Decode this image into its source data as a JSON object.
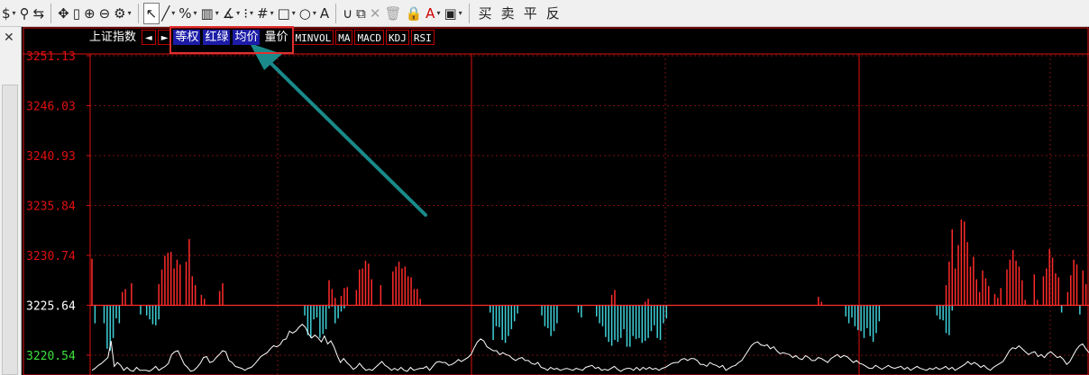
{
  "toolbar": {
    "items": [
      {
        "id": "currency",
        "glyph": "$",
        "dropdown": true
      },
      {
        "id": "filter",
        "glyph": "⚲",
        "dropdown": false
      },
      {
        "id": "fit",
        "glyph": "⇆",
        "dropdown": false
      },
      {
        "id": "move",
        "glyph": "✥",
        "dropdown": false
      },
      {
        "id": "candle",
        "glyph": "▯",
        "dropdown": false
      },
      {
        "id": "zoom-in",
        "glyph": "⊕",
        "dropdown": false
      },
      {
        "id": "zoom-out",
        "glyph": "⊖",
        "dropdown": false
      },
      {
        "id": "settings",
        "glyph": "⚙",
        "dropdown": true
      },
      {
        "id": "pointer",
        "glyph": "↖",
        "dropdown": false,
        "active": true
      },
      {
        "id": "line",
        "glyph": "╱",
        "dropdown": true
      },
      {
        "id": "percent",
        "glyph": "%",
        "dropdown": true
      },
      {
        "id": "ruler",
        "glyph": "▥",
        "dropdown": true
      },
      {
        "id": "angle",
        "glyph": "∡",
        "dropdown": true
      },
      {
        "id": "channel",
        "glyph": "⁝",
        "dropdown": true
      },
      {
        "id": "grid",
        "glyph": "#",
        "dropdown": true
      },
      {
        "id": "rect",
        "glyph": "□",
        "dropdown": true
      },
      {
        "id": "circle",
        "glyph": "○",
        "dropdown": true
      },
      {
        "id": "text",
        "glyph": "A",
        "dropdown": false
      },
      {
        "id": "magnet",
        "glyph": "∪",
        "dropdown": false
      },
      {
        "id": "copy",
        "glyph": "⧉",
        "dropdown": false
      },
      {
        "id": "delete",
        "glyph": "✕",
        "dropdown": false,
        "disabled": true
      },
      {
        "id": "trash",
        "glyph": "🗑",
        "dropdown": false,
        "disabled": true
      },
      {
        "id": "lock",
        "glyph": "🔒",
        "dropdown": false
      },
      {
        "id": "font-color",
        "glyph": "A",
        "dropdown": true,
        "red": true
      },
      {
        "id": "save",
        "glyph": "▣",
        "dropdown": true
      }
    ],
    "trade": [
      "买",
      "卖",
      "平",
      "反"
    ]
  },
  "legend": {
    "index_name": "上证指数",
    "left_arrow": "◄",
    "right_arrow": "►",
    "equal_weight": "等权",
    "red_green": "红绿",
    "avg_price": "均价",
    "volume_price": "量价",
    "indicators": [
      "MINVOL",
      "MA",
      "MACD",
      "KDJ",
      "RSI"
    ]
  },
  "colors": {
    "up": "#ff2a2a",
    "down": "#3fd0d8",
    "line": "#ffffff",
    "axis_red": "#e01010",
    "axis_green": "#3ee03e",
    "grid": "#7a1010"
  },
  "chart_data": {
    "type": "bar",
    "y_ticks": [
      "3251.13",
      "3246.03",
      "3240.93",
      "3235.84",
      "3230.74",
      "3225.64",
      "3220.54"
    ],
    "ylim": [
      3220.54,
      3251.13
    ],
    "baseline": 3225.64,
    "bars": [
      3230.4,
      3225.6,
      3225.6,
      3225.6,
      3225.6,
      3225.6,
      3225.6,
      3225.6,
      3225.6,
      3225.6,
      3227.0,
      3227.3,
      3225.6,
      3227.9,
      3225.6,
      3225.6,
      3225.6,
      3225.6,
      3225.6,
      3225.6,
      3225.6,
      3225.6,
      3227.8,
      3229.3,
      3230.7,
      3231.0,
      3231.1,
      3229.4,
      3230.3,
      3229.8,
      3225.6,
      3230.1,
      3232.4,
      3228.6,
      3227.7,
      3225.6,
      3226.7,
      3226.3,
      3225.6,
      3225.6,
      3225.6,
      3225.6,
      3227.1,
      3227.9,
      3225.6,
      3225.6,
      3225.6,
      3225.6,
      3225.6,
      3225.6,
      3225.6,
      3225.6,
      3225.6,
      3225.6,
      3225.6,
      3225.6,
      3225.6,
      3225.6,
      3225.6,
      3225.6,
      3225.6,
      3225.6,
      3225.6,
      3225.6,
      3225.6,
      3225.6,
      3225.6,
      3225.6,
      3225.6,
      3225.6,
      3225.6,
      3225.6,
      3225.6,
      3225.6,
      3225.6,
      3225.6,
      3225.6,
      3225.6,
      3228.2,
      3227.3,
      3226.4,
      3225.6,
      3226.6,
      3227.4,
      3227.5,
      3225.6,
      3225.6,
      3227.2,
      3229.3,
      3229.4,
      3230.2,
      3229.9,
      3228.3,
      3225.6,
      3225.6,
      3227.7,
      3225.6,
      3225.6,
      3225.6,
      3229.1,
      3229.6,
      3230.1,
      3229.4,
      3229.6,
      3228.6,
      3228.5,
      3227.3,
      3227.3,
      3226.3,
      3225.6,
      3225.6,
      3225.6,
      3225.6,
      3225.6,
      3225.6,
      3225.6,
      3225.6,
      3225.6,
      3225.6,
      3225.6,
      3225.6,
      3225.6,
      3225.6,
      3225.6,
      3225.6,
      3225.6,
      3225.6,
      3225.6,
      3225.6,
      3225.6,
      3225.6,
      3225.6,
      3225.6,
      3225.6,
      3225.6,
      3225.6,
      3225.6,
      3225.6,
      3225.6,
      3225.6,
      3225.6,
      3225.6,
      3225.6,
      3225.6,
      3225.6,
      3225.6,
      3225.6,
      3225.6,
      3225.6,
      3225.6,
      3225.6,
      3225.6,
      3225.6,
      3225.6,
      3225.6,
      3225.6,
      3225.6,
      3225.6,
      3225.6,
      3225.6,
      3225.6,
      3225.6,
      3225.6,
      3225.6,
      3225.6,
      3225.6,
      3225.6,
      3225.6,
      3225.6,
      3225.6,
      3225.6,
      3226.7,
      3227.2,
      3225.6,
      3225.6,
      3225.6,
      3225.6,
      3225.6,
      3225.6,
      3225.6,
      3225.6,
      3225.6,
      3226.0,
      3226.3,
      3225.6,
      3225.6,
      3225.6,
      3225.6,
      3225.6,
      3225.6,
      3225.6,
      3225.6,
      3225.6,
      3225.6,
      3225.6,
      3225.6,
      3225.6,
      3225.6,
      3225.6,
      3225.6,
      3225.6,
      3225.6,
      3225.6,
      3225.6,
      3225.6,
      3225.6,
      3225.6,
      3225.6,
      3225.6,
      3225.6,
      3225.6,
      3225.6,
      3225.6,
      3225.6,
      3225.6,
      3225.6,
      3225.6,
      3225.6,
      3225.6,
      3225.6,
      3225.6,
      3225.6,
      3225.6,
      3225.6,
      3225.6,
      3225.6,
      3225.6,
      3225.6,
      3225.6,
      3225.6,
      3225.6,
      3225.6,
      3225.6,
      3225.6,
      3225.6,
      3225.6,
      3225.6,
      3225.6,
      3225.6,
      3226.5,
      3226.0,
      3225.6,
      3225.6,
      3225.6,
      3225.6,
      3225.6,
      3225.6,
      3225.6,
      3225.6,
      3225.6,
      3225.6,
      3225.6,
      3225.6,
      3225.6,
      3225.6,
      3225.6,
      3225.6,
      3225.6,
      3225.6,
      3225.6,
      3225.6,
      3225.6,
      3225.6,
      3225.6,
      3225.6,
      3225.6,
      3225.6,
      3225.6,
      3225.6,
      3225.6,
      3225.6,
      3225.6,
      3225.6,
      3225.6,
      3225.6,
      3225.6,
      3225.6,
      3225.6,
      3225.6,
      3225.6,
      3225.6,
      3227.7,
      3230.1,
      3233.4,
      3229.4,
      3231.8,
      3234.4,
      3234.2,
      3232.1,
      3229.6,
      3230.6,
      3228.3,
      3227.0,
      3229.2,
      3228.4,
      3227.6,
      3225.6,
      3226.8,
      3226.4,
      3227.4,
      3225.6,
      3229.3,
      3230.3,
      3231.3,
      3230.2,
      3229.6,
      3228.2,
      3226.2,
      3225.6,
      3225.6,
      3228.8,
      3226.2,
      3225.6,
      3228.6,
      3229.4,
      3231.4,
      3230.5,
      3228.9,
      3228.5,
      3225.6,
      3225.6,
      3227.0,
      3228.7,
      3230.3,
      3229.8,
      3225.6,
      3229.2,
      3227.8
    ],
    "downbars": [
      3225.64,
      3223.8,
      3225.64,
      3225.64,
      3223.8,
      3221.2,
      3221.0,
      3222.3,
      3224.3,
      3223.8,
      3225.64,
      3225.64,
      3225.64,
      3225.64,
      3225.64,
      3225.64,
      3224.7,
      3225.64,
      3224.6,
      3224.2,
      3223.7,
      3223.6,
      3224.2,
      3225.64,
      3225.64,
      3225.64,
      3225.64,
      3225.64,
      3225.64,
      3225.64,
      3225.64,
      3225.64,
      3225.64,
      3225.64,
      3225.64,
      3225.64,
      3225.64,
      3225.64,
      3225.64,
      3225.64,
      3225.64,
      3225.64,
      3225.64,
      3225.64,
      3225.64,
      3225.64,
      3225.64,
      3225.64,
      3225.64,
      3225.64,
      3225.64,
      3225.64,
      3225.64,
      3225.64,
      3225.64,
      3225.64,
      3225.64,
      3225.64,
      3225.64,
      3225.64,
      3225.64,
      3225.64,
      3225.64,
      3225.64,
      3225.64,
      3225.64,
      3225.64,
      3225.64,
      3225.64,
      3225.64,
      3224.6,
      3222.6,
      3222.3,
      3224.2,
      3224.4,
      3222.3,
      3222.7,
      3223.2,
      3225.3,
      3225.5,
      3223.8,
      3224.3,
      3225.0,
      3225.3,
      3225.64,
      3225.64,
      3225.64,
      3225.64,
      3225.64,
      3225.64,
      3225.64,
      3225.64,
      3225.64,
      3225.64,
      3225.64,
      3225.64,
      3225.64,
      3225.64,
      3225.64,
      3225.64,
      3225.64,
      3225.64,
      3225.64,
      3225.64,
      3225.64,
      3225.64,
      3225.64,
      3225.64,
      3225.64,
      3225.64,
      3225.64,
      3225.64,
      3225.64,
      3225.64,
      3225.64,
      3225.64,
      3225.64,
      3225.64,
      3225.64,
      3225.64,
      3225.64,
      3225.64,
      3225.64,
      3225.64,
      3225.64,
      3225.64,
      3225.64,
      3225.64,
      3225.64,
      3225.64,
      3225.64,
      3224.9,
      3222.1,
      3223.5,
      3223.4,
      3222.1,
      3221.8,
      3222.5,
      3223.2,
      3224.0,
      3224.8,
      3225.64,
      3225.64,
      3225.64,
      3225.64,
      3225.64,
      3225.64,
      3225.64,
      3224.6,
      3223.5,
      3223.3,
      3222.5,
      3223.0,
      3223.8,
      3225.64,
      3225.64,
      3225.64,
      3225.64,
      3225.64,
      3225.64,
      3224.9,
      3224.4,
      3225.64,
      3225.64,
      3225.64,
      3225.64,
      3224.5,
      3223.8,
      3223.5,
      3222.4,
      3221.9,
      3221.5,
      3222.1,
      3221.9,
      3222.3,
      3223.2,
      3221.4,
      3221.4,
      3222.5,
      3222.2,
      3222.3,
      3221.8,
      3222.0,
      3222.3,
      3223.0,
      3223.6,
      3222.3,
      3222.1,
      3223.8,
      3224.3,
      3225.64,
      3225.64,
      3225.64,
      3225.64,
      3225.64,
      3225.64,
      3225.64,
      3225.64,
      3225.64,
      3225.64,
      3225.64,
      3225.64,
      3225.64,
      3225.64,
      3225.64,
      3225.64,
      3225.64,
      3225.64,
      3225.64,
      3225.64,
      3225.64,
      3225.64,
      3225.64,
      3225.64,
      3225.64,
      3225.64,
      3225.64,
      3225.64,
      3225.64,
      3225.64,
      3225.64,
      3225.64,
      3225.64,
      3225.64,
      3225.64,
      3225.64,
      3225.64,
      3225.64,
      3225.64,
      3225.64,
      3225.64,
      3225.64,
      3225.64,
      3225.64,
      3225.64,
      3225.64,
      3225.64,
      3225.64,
      3225.64,
      3225.64,
      3225.64,
      3225.64,
      3225.64,
      3225.64,
      3225.64,
      3225.64,
      3225.64,
      3225.64,
      3224.5,
      3223.8,
      3224.4,
      3223.5,
      3223.1,
      3223.0,
      3222.3,
      3223.3,
      3222.5,
      3221.9,
      3222.8,
      3224.0,
      3225.64,
      3225.64,
      3225.64,
      3225.64,
      3225.64,
      3225.64,
      3225.64,
      3225.64,
      3225.64,
      3225.64,
      3225.64,
      3225.64,
      3225.64,
      3225.64,
      3225.64,
      3225.64,
      3225.64,
      3225.64,
      3224.6,
      3224.2,
      3224.1,
      3222.8,
      3222.6,
      3225.1,
      3225.64,
      3225.64,
      3225.64,
      3225.64,
      3225.64,
      3225.64,
      3225.64,
      3225.64,
      3225.64,
      3225.64,
      3225.64,
      3225.64,
      3225.64,
      3225.64,
      3225.64,
      3225.64,
      3225.64,
      3225.64,
      3225.64,
      3225.64,
      3225.64,
      3225.64,
      3225.64,
      3225.64,
      3225.64,
      3225.64,
      3225.64,
      3225.64,
      3225.64,
      3225.64,
      3225.64,
      3225.64,
      3225.64,
      3225.64,
      3225.64,
      3224.9,
      3225.64,
      3225.64,
      3225.64,
      3225.64,
      3225.64,
      3224.7,
      3225.64
    ],
    "line": [
      3219.0,
      3219.2,
      3219.5,
      3219.7,
      3220.0,
      3220.3,
      3222.0,
      3219.4,
      3219.8,
      3219.5,
      3219.0,
      3219.3,
      3219.0,
      3218.9,
      3219.3,
      3219.0,
      3219.0,
      3219.0,
      3218.9,
      3219.1,
      3219.4,
      3219.0,
      3219.2,
      3219.4,
      3219.7,
      3220.6,
      3220.9,
      3221.0,
      3220.3,
      3219.6,
      3219.3,
      3218.9,
      3219.0,
      3219.3,
      3219.7,
      3220.3,
      3220.4,
      3219.8,
      3219.9,
      3220.3,
      3220.6,
      3221.0,
      3220.9,
      3220.0,
      3219.8,
      3219.4,
      3219.3,
      3219.2,
      3219.0,
      3219.2,
      3219.3,
      3219.6,
      3220.0,
      3220.4,
      3220.6,
      3220.8,
      3221.2,
      3221.5,
      3221.4,
      3221.6,
      3222.1,
      3222.2,
      3223.0,
      3222.8,
      3223.0,
      3223.4,
      3223.7,
      3223.4,
      3222.7,
      3222.3,
      3222.6,
      3222.3,
      3221.9,
      3222.5,
      3221.7,
      3222.0,
      3221.4,
      3220.5,
      3219.8,
      3220.2,
      3219.8,
      3219.5,
      3219.1,
      3219.3,
      3219.7,
      3219.3,
      3219.0,
      3219.1,
      3219.0,
      3219.3,
      3219.6,
      3219.9,
      3219.5,
      3219.3,
      3219.0,
      3219.2,
      3219.0,
      3219.3,
      3219.0,
      3218.9,
      3219.3,
      3219.0,
      3219.1,
      3219.2,
      3219.2,
      3219.4,
      3219.0,
      3219.4,
      3219.8,
      3219.9,
      3219.8,
      3219.8,
      3219.5,
      3219.6,
      3219.8,
      3220.1,
      3219.9,
      3220.1,
      3220.3,
      3220.6,
      3221.3,
      3221.9,
      3222.2,
      3222.0,
      3221.4,
      3221.2,
      3221.0,
      3221.0,
      3220.6,
      3220.8,
      3220.6,
      3220.5,
      3220.2,
      3220.0,
      3220.2,
      3220.3,
      3220.0,
      3220.0,
      3219.7,
      3219.6,
      3219.8,
      3219.3,
      3219.2,
      3219.0,
      3219.3,
      3219.1,
      3219.2,
      3219.0,
      3219.1,
      3219.2,
      3219.1,
      3219.0,
      3219.2,
      3219.1,
      3219.0,
      3219.3,
      3219.4,
      3219.5,
      3219.2,
      3219.3,
      3219.0,
      3219.1,
      3219.0,
      3219.2,
      3219.4,
      3219.1,
      3218.9,
      3219.1,
      3219.2,
      3219.2,
      3219.0,
      3219.3,
      3219.0,
      3219.3,
      3219.1,
      3219.3,
      3219.1,
      3219.2,
      3219.0,
      3219.2,
      3219.3,
      3219.5,
      3219.7,
      3219.8,
      3219.8,
      3220.1,
      3220.2,
      3220.0,
      3220.2,
      3220.2,
      3220.0,
      3219.6,
      3219.6,
      3219.4,
      3219.8,
      3219.6,
      3219.5,
      3219.3,
      3219.5,
      3219.0,
      3219.2,
      3219.4,
      3219.5,
      3219.8,
      3220.0,
      3220.5,
      3221.0,
      3221.5,
      3221.8,
      3221.9,
      3221.6,
      3221.5,
      3221.6,
      3221.2,
      3221.4,
      3221.0,
      3220.7,
      3220.8,
      3220.7,
      3220.6,
      3220.3,
      3220.5,
      3220.2,
      3220.1,
      3220.5,
      3220.3,
      3220.0,
      3220.0,
      3220.3,
      3220.2,
      3220.0,
      3219.8,
      3220.2,
      3220.4,
      3220.6,
      3220.3,
      3220.5,
      3220.4,
      3220.1,
      3219.8,
      3220.0,
      3219.7,
      3219.6,
      3219.4,
      3219.2,
      3219.2,
      3219.5,
      3219.3,
      3219.1,
      3219.3,
      3219.5,
      3219.3,
      3219.2,
      3219.3,
      3219.4,
      3219.1,
      3219.3,
      3219.0,
      3219.2,
      3219.4,
      3219.2,
      3219.1,
      3219.0,
      3219.2,
      3219.1,
      3219.3,
      3219.1,
      3219.2,
      3219.4,
      3219.1,
      3219.3,
      3219.0,
      3219.2,
      3219.4,
      3219.6,
      3219.9,
      3219.6,
      3219.8,
      3219.6,
      3219.3,
      3219.5,
      3219.2,
      3219.0,
      3219.3,
      3219.5,
      3219.7,
      3219.9,
      3220.4,
      3221.0,
      3221.3,
      3221.2,
      3221.5,
      3221.2,
      3220.9,
      3220.6,
      3220.8,
      3220.9,
      3220.4,
      3220.6,
      3220.3,
      3220.7,
      3220.9,
      3220.6,
      3220.3,
      3220.4,
      3220.1,
      3219.6,
      3219.9,
      3220.5,
      3221.1,
      3221.5,
      3221.7,
      3221.2,
      3220.8
    ]
  }
}
